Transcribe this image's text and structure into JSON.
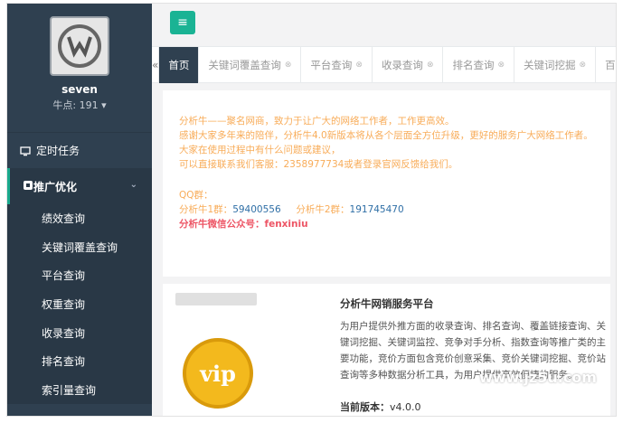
{
  "user": {
    "name": "seven",
    "points": "牛点: 191 ▾"
  },
  "sidebar": {
    "top_item": "定时任务",
    "group": {
      "label": "推广优化",
      "items": [
        "绩效查询",
        "关键词覆盖查询",
        "平台查询",
        "权重查询",
        "收录查询",
        "排名查询",
        "索引量查询"
      ]
    }
  },
  "tabs": [
    {
      "label": "首页",
      "active": true
    },
    {
      "label": "关键词覆盖查询"
    },
    {
      "label": "平台查询"
    },
    {
      "label": "收录查询"
    },
    {
      "label": "排名查询"
    },
    {
      "label": "关键词挖掘"
    },
    {
      "label": "百度指"
    }
  ],
  "notice": {
    "lines": [
      "分析牛——聚名网商，致力于让广大的网络工作者，工作更高效。",
      "感谢大家多年来的陪伴，分析牛4.0新版本将从各个层面全方位升级，更好的服务广大网络工作者。",
      "大家在使用过程中有什么问题或建议，",
      "可以直接联系我们客服：2358977734或者登录官网反馈给我们。"
    ],
    "qq_label": "QQ群：",
    "qq1_label": "分析牛1群：",
    "qq1": "59400556",
    "qq2_label": "分析牛2群：",
    "qq2": "191745470",
    "wechat": "分析牛微信公众号：fenxiniu"
  },
  "service": {
    "title": "分析牛网销服务平台",
    "description": "为用户提供外推方面的收录查询、排名查询、覆盖链接查询、关键词挖掘、关键词监控、竞争对手分析、指数查询等推广类的主要功能，竞价方面包含竞价创意采集、竞价关键词挖掘、竞价站查询等多种数据分析工具，为用户提供高效便捷的服务。",
    "version_label": "当前版本：",
    "version": "v4.0.0",
    "badge": "vip"
  },
  "watermark": "www.jz5u.com"
}
